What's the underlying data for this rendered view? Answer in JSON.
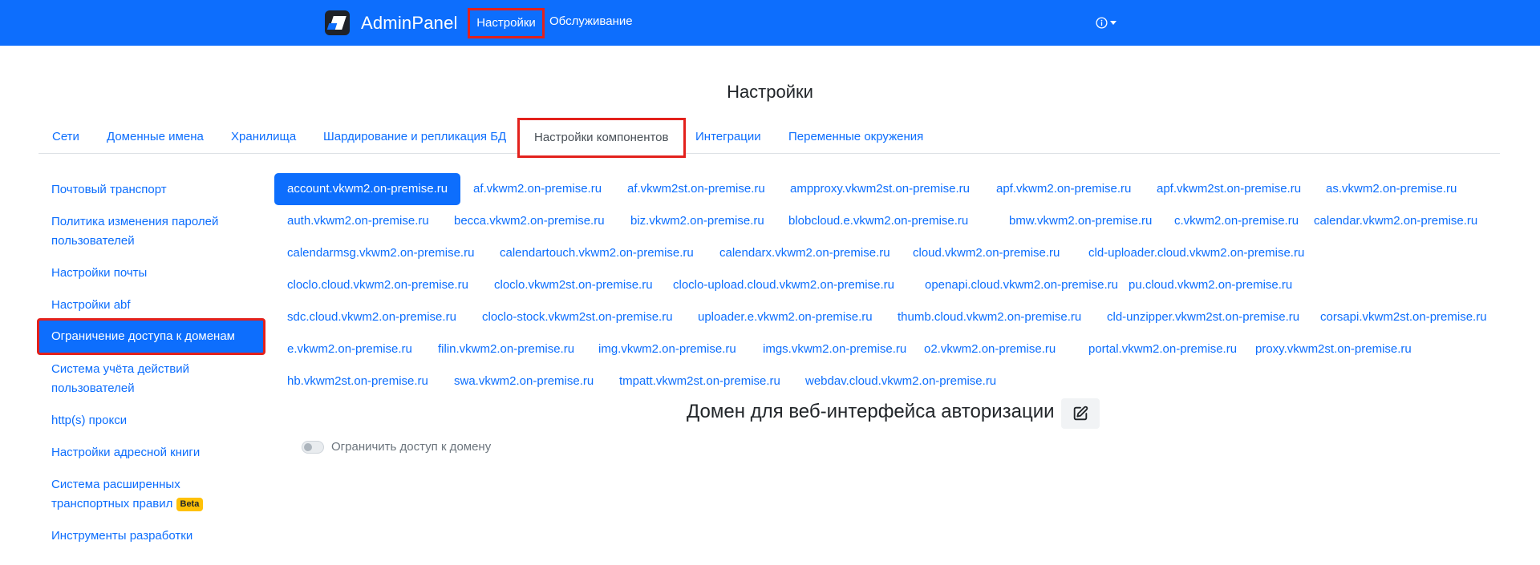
{
  "navbar": {
    "brand": "AdminPanel",
    "links": [
      "Настройки",
      "Обслуживание"
    ],
    "info_icon": "info-circle-icon",
    "accent": "#0d6efd"
  },
  "page": {
    "title": "Настройки"
  },
  "tabs": [
    "Сети",
    "Доменные имена",
    "Хранилища",
    "Шардирование и репликация БД",
    "Настройки компонентов",
    "Интеграции",
    "Переменные окружения"
  ],
  "active_tab": "Настройки компонентов",
  "sidebar": {
    "items": [
      {
        "line1": "Почтовый транспорт",
        "line2": ""
      },
      {
        "line1": "Политика изменения паролей",
        "line2": "пользователей"
      },
      {
        "line1": "Настройки почты",
        "line2": ""
      },
      {
        "line1": "Настройки abf",
        "line2": ""
      },
      {
        "line1": "Ограничение доступа к доменам",
        "line2": ""
      },
      {
        "line1": "Система учёта действий",
        "line2": "пользователей"
      },
      {
        "line1": "http(s) прокси",
        "line2": ""
      },
      {
        "line1": "Настройки адресной книги",
        "line2": ""
      },
      {
        "line1": "Система расширенных",
        "line2": "транспортных правил",
        "badge": "Beta"
      },
      {
        "line1": "Инструменты разработки",
        "line2": ""
      }
    ],
    "active": "Ограничение доступа к доменам"
  },
  "domains": [
    [
      "account.vkwm2.on-premise.ru",
      "af.vkwm2.on-premise.ru",
      "af.vkwm2st.on-premise.ru",
      "ampproxy.vkwm2st.on-premise.ru",
      "apf.vkwm2.on-premise.ru",
      "apf.vkwm2st.on-premise.ru",
      "as.vkwm2.on-premise.ru"
    ],
    [
      "auth.vkwm2.on-premise.ru",
      "becca.vkwm2.on-premise.ru",
      "biz.vkwm2.on-premise.ru",
      "blobcloud.e.vkwm2.on-premise.ru",
      "bmw.vkwm2.on-premise.ru",
      "c.vkwm2.on-premise.ru",
      "calendar.vkwm2.on-premise.ru"
    ],
    [
      "calendarmsg.vkwm2.on-premise.ru",
      "calendartouch.vkwm2.on-premise.ru",
      "calendarx.vkwm2.on-premise.ru",
      "cloud.vkwm2.on-premise.ru",
      "cld-uploader.cloud.vkwm2.on-premise.ru"
    ],
    [
      "cloclo.cloud.vkwm2.on-premise.ru",
      "cloclo.vkwm2st.on-premise.ru",
      "cloclo-upload.cloud.vkwm2.on-premise.ru",
      "openapi.cloud.vkwm2.on-premise.ru",
      "pu.cloud.vkwm2.on-premise.ru"
    ],
    [
      "sdc.cloud.vkwm2.on-premise.ru",
      "cloclo-stock.vkwm2st.on-premise.ru",
      "uploader.e.vkwm2.on-premise.ru",
      "thumb.cloud.vkwm2.on-premise.ru",
      "cld-unzipper.vkwm2st.on-premise.ru",
      "corsapi.vkwm2st.on-premise.ru"
    ],
    [
      "e.vkwm2.on-premise.ru",
      "filin.vkwm2.on-premise.ru",
      "img.vkwm2.on-premise.ru",
      "imgs.vkwm2.on-premise.ru",
      "o2.vkwm2.on-premise.ru",
      "portal.vkwm2.on-premise.ru",
      "proxy.vkwm2st.on-premise.ru"
    ],
    [
      "hb.vkwm2st.on-premise.ru",
      "swa.vkwm2.on-premise.ru",
      "tmpatt.vkwm2st.on-premise.ru",
      "webdav.cloud.vkwm2.on-premise.ru"
    ]
  ],
  "active_domain": "account.vkwm2.on-premise.ru",
  "section": {
    "title": "Домен для веб-интерфейса авторизации",
    "edit_icon": "edit-icon",
    "toggle_label": "Ограничить доступ к домену",
    "toggle_on": false
  }
}
